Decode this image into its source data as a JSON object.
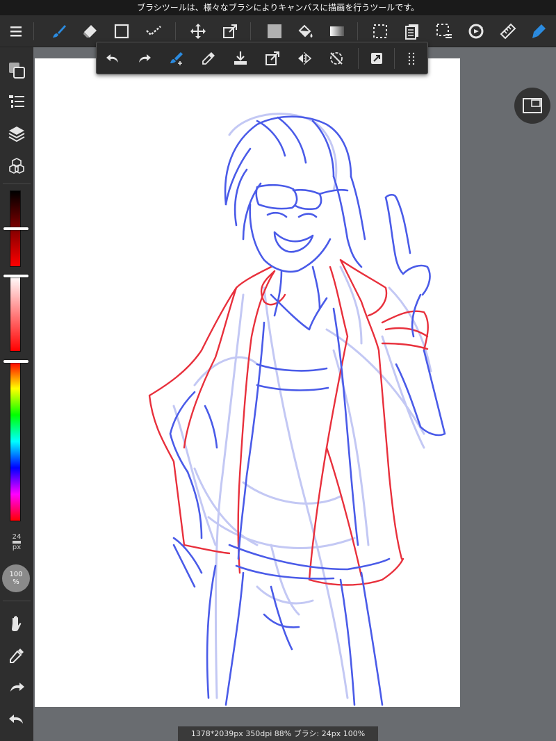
{
  "tooltip": "ブラシツールは、様々なブラシによりキャンバスに描画を行うツールです。",
  "toolbar": {
    "left_tools": [
      {
        "name": "brush-tool",
        "icon": "brush-icon",
        "active": true
      },
      {
        "name": "eraser-tool",
        "icon": "eraser-icon"
      },
      {
        "name": "shape-tool",
        "icon": "square-outline-icon"
      },
      {
        "name": "select-pen-tool",
        "icon": "dotted-check-icon"
      }
    ],
    "right_tools": [
      {
        "name": "move-tool",
        "icon": "move-arrows-icon"
      },
      {
        "name": "transform-tool",
        "icon": "transform-icon"
      },
      {
        "name": "fill-color-tool",
        "icon": "filled-square-icon"
      },
      {
        "name": "bucket-tool",
        "icon": "paint-bucket-icon"
      },
      {
        "name": "gradient-tool",
        "icon": "gradient-icon"
      },
      {
        "name": "select-tool",
        "icon": "marquee-icon"
      },
      {
        "name": "copy-tool",
        "icon": "document-copy-icon"
      },
      {
        "name": "select-erase-tool",
        "icon": "marquee-erase-icon"
      },
      {
        "name": "rotate-tool",
        "icon": "rotate-icon"
      },
      {
        "name": "ruler-tool",
        "icon": "ruler-icon"
      },
      {
        "name": "pen-highlight-tool",
        "icon": "pen-nib-icon"
      }
    ]
  },
  "float_toolbar": [
    "undo-icon",
    "redo-icon",
    "brush-settings-icon",
    "eyedropper-icon",
    "download-icon",
    "export-icon",
    "flip-horizontal-icon",
    "rotate-lock-icon",
    "snap-icon",
    "grid-dots-icon"
  ],
  "sidebar": {
    "brush_size_value": "24",
    "brush_size_unit": "px",
    "opacity_value": "100",
    "opacity_unit": "%",
    "color_hue_fraction": 0.0,
    "color_brightness_fraction": 0.5,
    "color_saturation_fraction": 1.0
  },
  "colors": {
    "primary": "#ff1a1a",
    "accent": "#1e88e5",
    "sketch_blue": "#4a5be8",
    "sketch_red": "#e8303c"
  },
  "info": "1378*2039px 350dpi 88% ブラシ: 24px 100%"
}
